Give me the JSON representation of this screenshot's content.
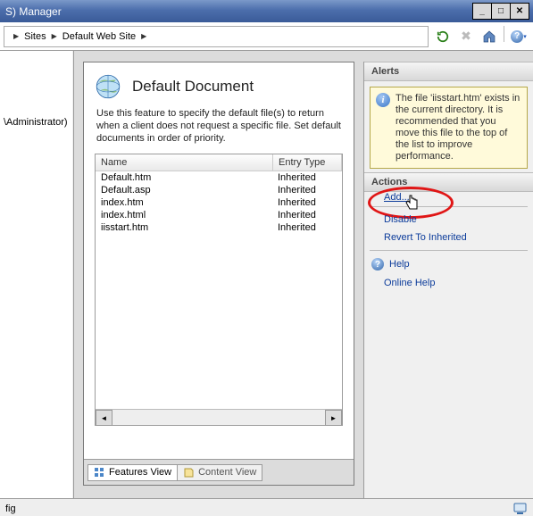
{
  "window": {
    "title_fragment": "S) Manager"
  },
  "breadcrumb": {
    "items": [
      "Sites",
      "Default Web Site"
    ]
  },
  "tree": {
    "node": "\\Administrator)"
  },
  "main": {
    "title": "Default Document",
    "description": "Use this feature to specify the default file(s) to return when a client does not request a specific file. Set default documents in order of priority.",
    "columns": {
      "name": "Name",
      "entry_type": "Entry Type"
    },
    "rows": [
      {
        "name": "Default.htm",
        "type": "Inherited"
      },
      {
        "name": "Default.asp",
        "type": "Inherited"
      },
      {
        "name": "index.htm",
        "type": "Inherited"
      },
      {
        "name": "index.html",
        "type": "Inherited"
      },
      {
        "name": "iisstart.htm",
        "type": "Inherited"
      }
    ],
    "tabs": {
      "features": "Features View",
      "content": "Content View"
    }
  },
  "alerts": {
    "header": "Alerts",
    "message": "The file 'iisstart.htm' exists in the current directory. It is recommended that you move this file to the top of the list to improve performance."
  },
  "actions": {
    "header": "Actions",
    "add": "Add...",
    "disable": "Disable",
    "revert": "Revert To Inherited",
    "help": "Help",
    "online_help": "Online Help"
  },
  "status": {
    "left": "fig"
  }
}
